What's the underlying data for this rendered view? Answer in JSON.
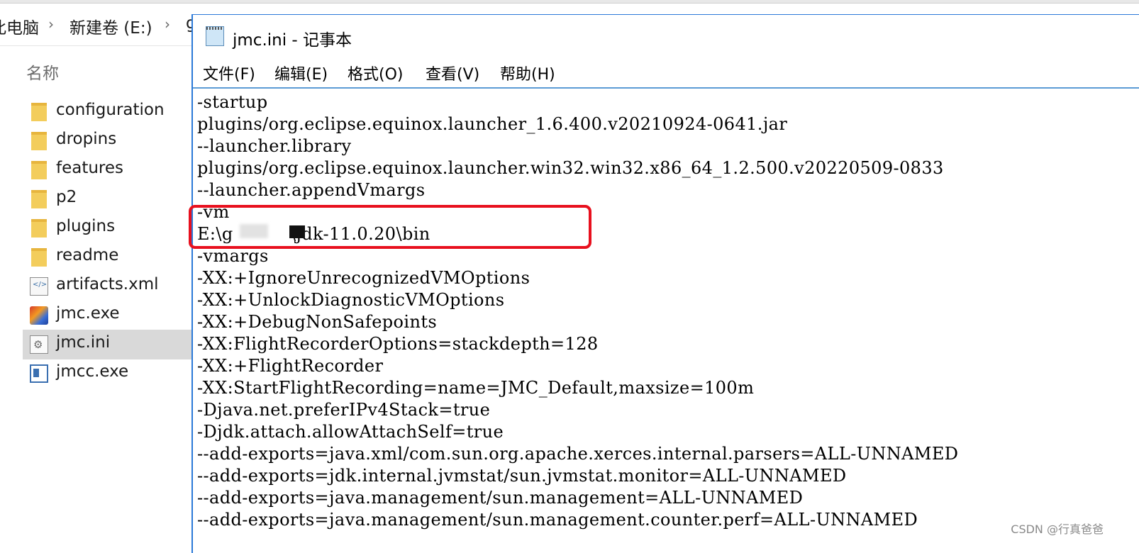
{
  "explorer": {
    "breadcrumb": [
      "此电脑",
      "新建卷 (E:)",
      "g"
    ],
    "column_header": "名称",
    "files": [
      {
        "name": "configuration",
        "icon": "folder-icon"
      },
      {
        "name": "dropins",
        "icon": "folder-icon"
      },
      {
        "name": "features",
        "icon": "folder-icon"
      },
      {
        "name": "p2",
        "icon": "folder-icon"
      },
      {
        "name": "plugins",
        "icon": "folder-icon"
      },
      {
        "name": "readme",
        "icon": "folder-icon"
      },
      {
        "name": "artifacts.xml",
        "icon": "xml-file-icon"
      },
      {
        "name": "jmc.exe",
        "icon": "jmc-exe-icon"
      },
      {
        "name": "jmc.ini",
        "icon": "ini-file-icon",
        "selected": true
      },
      {
        "name": "jmcc.exe",
        "icon": "app-window-icon"
      }
    ]
  },
  "notepad": {
    "title": "jmc.ini - 记事本",
    "menu": [
      "文件(F)",
      "编辑(E)",
      "格式(O)",
      "查看(V)",
      "帮助(H)"
    ],
    "lines": [
      "-startup",
      "plugins/org.eclipse.equinox.launcher_1.6.400.v20210924-0641.jar",
      "--launcher.library",
      "plugins/org.eclipse.equinox.launcher.win32.win32.x86_64_1.2.500.v20220509-0833",
      "--launcher.appendVmargs",
      "-vm",
      "E:\\g          \\jdk-11.0.20\\bin",
      "-vmargs",
      "-XX:+IgnoreUnrecognizedVMOptions",
      "-XX:+UnlockDiagnosticVMOptions",
      "-XX:+DebugNonSafepoints",
      "-XX:FlightRecorderOptions=stackdepth=128",
      "-XX:+FlightRecorder",
      "-XX:StartFlightRecording=name=JMC_Default,maxsize=100m",
      "-Djava.net.preferIPv4Stack=true",
      "-Djdk.attach.allowAttachSelf=true",
      "--add-exports=java.xml/com.sun.org.apache.xerces.internal.parsers=ALL-UNNAMED",
      "--add-exports=jdk.internal.jvmstat/sun.jvmstat.monitor=ALL-UNNAMED",
      "--add-exports=java.management/sun.management=ALL-UNNAMED",
      "--add-exports=java.management/sun.management.counter.perf=ALL-UNNAMED"
    ]
  },
  "colors": {
    "highlight": "#e8101e",
    "accent": "#2b79d8"
  },
  "watermark": "CSDN @行真爸爸"
}
